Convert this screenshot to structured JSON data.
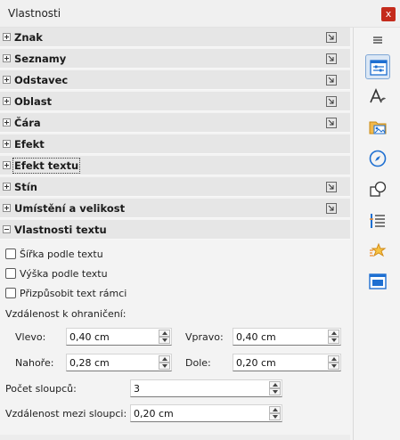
{
  "window": {
    "title": "Vlastnosti",
    "close_label": "x"
  },
  "sections": [
    {
      "label": "Znak",
      "expanded": false,
      "has_more": true
    },
    {
      "label": "Seznamy",
      "expanded": false,
      "has_more": true
    },
    {
      "label": "Odstavec",
      "expanded": false,
      "has_more": true
    },
    {
      "label": "Oblast",
      "expanded": false,
      "has_more": true
    },
    {
      "label": "Čára",
      "expanded": false,
      "has_more": true
    },
    {
      "label": "Efekt",
      "expanded": false,
      "has_more": false
    },
    {
      "label": "Efekt textu",
      "expanded": false,
      "has_more": false
    },
    {
      "label": "Stín",
      "expanded": false,
      "has_more": true
    },
    {
      "label": "Umístění a velikost",
      "expanded": false,
      "has_more": true
    },
    {
      "label": "Vlastnosti textu",
      "expanded": true,
      "has_more": false
    }
  ],
  "text_properties": {
    "checkboxes": [
      {
        "label": "Šířka podle textu",
        "checked": false
      },
      {
        "label": "Výška podle textu",
        "checked": false
      },
      {
        "label": "Přizpůsobit text rámci",
        "checked": false
      }
    ],
    "spacing_heading": "Vzdálenost k ohraničení:",
    "left_label": "Vlevo:",
    "left_value": "0,40 cm",
    "right_label": "Vpravo:",
    "right_value": "0,40 cm",
    "top_label": "Nahoře:",
    "top_value": "0,28 cm",
    "bottom_label": "Dole:",
    "bottom_value": "0,20 cm",
    "columns_label": "Počet sloupců:",
    "columns_value": "3",
    "column_spacing_label": "Vzdálenost mezi sloupci:",
    "column_spacing_value": "0,20 cm"
  },
  "deck": [
    {
      "icon": "menu-icon",
      "active": false
    },
    {
      "icon": "properties-icon",
      "active": true
    },
    {
      "icon": "styles-icon",
      "active": false
    },
    {
      "icon": "gallery-icon",
      "active": false
    },
    {
      "icon": "navigator-icon",
      "active": false
    },
    {
      "icon": "shapes-icon",
      "active": false
    },
    {
      "icon": "animation-icon",
      "active": false
    },
    {
      "icon": "slide-transition-icon",
      "active": false
    },
    {
      "icon": "master-slides-icon",
      "active": false
    }
  ],
  "colors": {
    "accent": "#1e6fd1",
    "close": "#c42b1c",
    "section_bg": "#e6e6e6"
  }
}
